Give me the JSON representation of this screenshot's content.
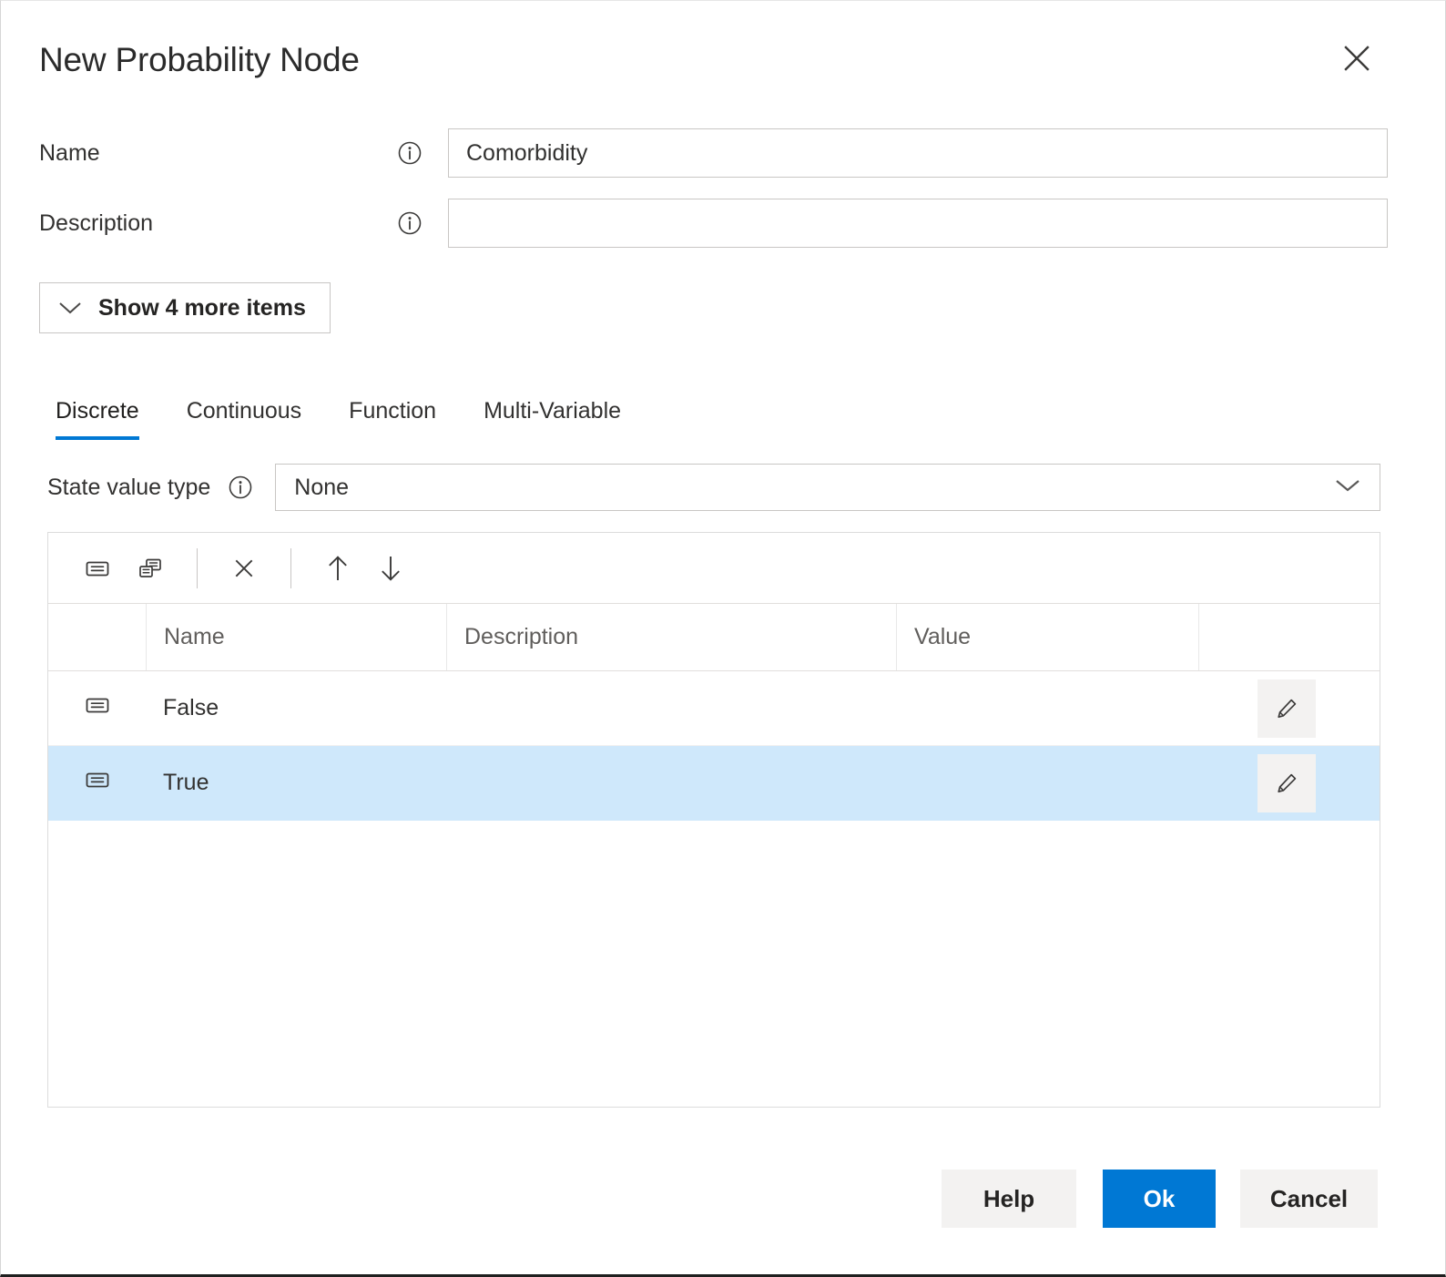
{
  "dialog": {
    "title": "New Probability Node",
    "close_icon": "close-icon"
  },
  "form": {
    "name": {
      "label": "Name",
      "info_icon": "info-icon",
      "value": "Comorbidity",
      "placeholder": ""
    },
    "description": {
      "label": "Description",
      "info_icon": "info-icon",
      "value": "",
      "placeholder": ""
    },
    "show_more": {
      "label": "Show 4 more items",
      "chevron_icon": "chevron-down-icon"
    }
  },
  "tabs": [
    {
      "label": "Discrete",
      "active": true
    },
    {
      "label": "Continuous",
      "active": false
    },
    {
      "label": "Function",
      "active": false
    },
    {
      "label": "Multi-Variable",
      "active": false
    }
  ],
  "state_value_type": {
    "label": "State value type",
    "info_icon": "info-icon",
    "selected": "None",
    "chevron_icon": "chevron-down-icon"
  },
  "table": {
    "toolbar": [
      {
        "name": "add-state-button",
        "icon": "state-icon",
        "title": "Add state"
      },
      {
        "name": "duplicate-state-button",
        "icon": "copy-state-icon",
        "title": "Duplicate state"
      },
      {
        "name": "delete-state-button",
        "icon": "close-x-icon",
        "title": "Delete state"
      },
      {
        "name": "move-up-button",
        "icon": "arrow-up-icon",
        "title": "Move up"
      },
      {
        "name": "move-down-button",
        "icon": "arrow-down-icon",
        "title": "Move down"
      }
    ],
    "columns": [
      "",
      "Name",
      "Description",
      "Value",
      ""
    ],
    "rows": [
      {
        "icon": "state-icon",
        "name": "False",
        "description": "",
        "value": "",
        "edit_icon": "pencil-icon",
        "selected": false
      },
      {
        "icon": "state-icon",
        "name": "True",
        "description": "",
        "value": "",
        "edit_icon": "pencil-icon",
        "selected": true
      }
    ]
  },
  "footer": {
    "help_label": "Help",
    "ok_label": "Ok",
    "cancel_label": "Cancel"
  },
  "colors": {
    "accent": "#0078d4",
    "selected_row": "#cfe8fb",
    "button_neutral": "#f3f2f1",
    "border": "#c8c6c4",
    "text": "#323130",
    "muted_text": "#605e5c"
  }
}
